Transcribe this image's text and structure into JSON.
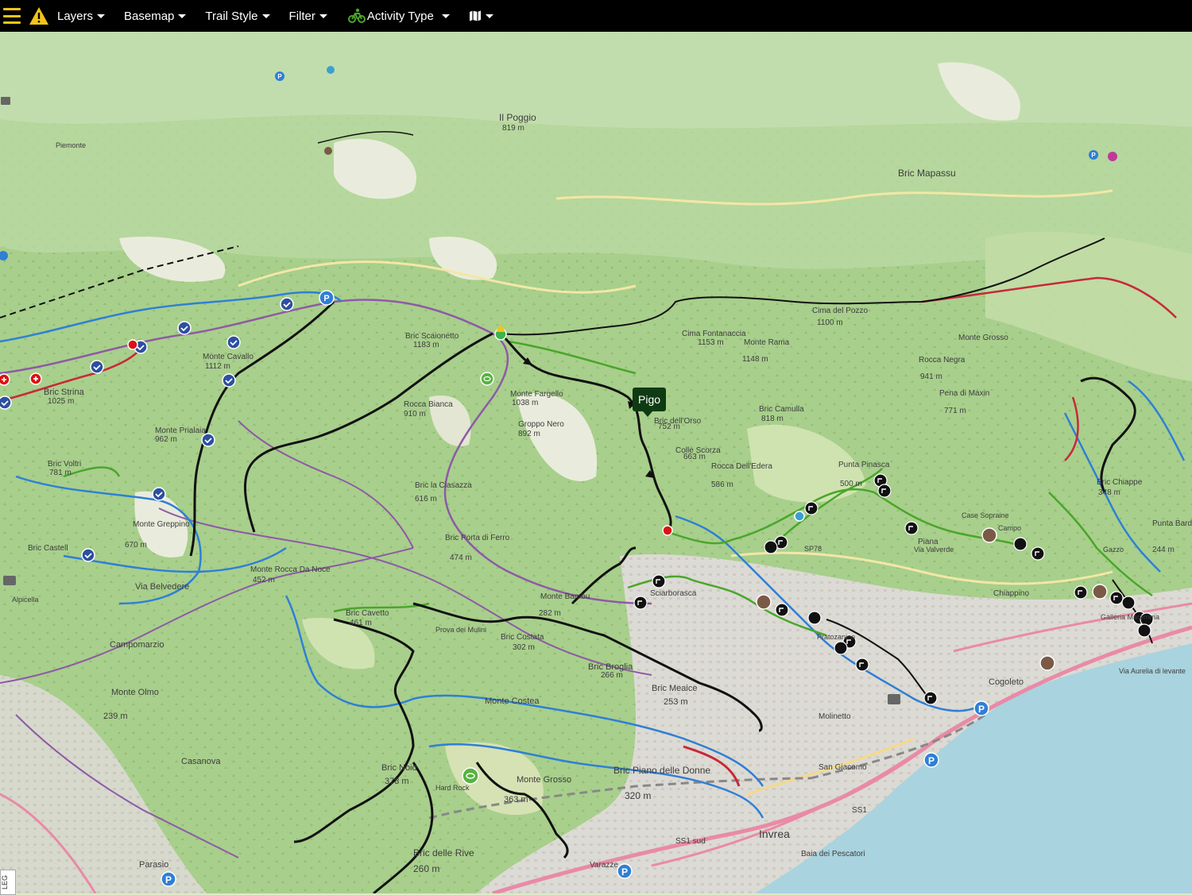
{
  "toolbar": {
    "menus": [
      {
        "label": "Layers"
      },
      {
        "label": "Basemap"
      },
      {
        "label": "Trail Style"
      },
      {
        "label": "Filter"
      },
      {
        "label": "Activity Type"
      }
    ]
  },
  "popup": {
    "label": "Pigo"
  },
  "legend": {
    "label": "LEG"
  },
  "places": [
    {
      "name": "Il Poggio",
      "elev": "819 m"
    },
    {
      "name": "Bric Mapassu"
    },
    {
      "name": "Bric Scaionetto",
      "elev": "1183 m"
    },
    {
      "name": "Monte Cavallo",
      "elev": "1112 m"
    },
    {
      "name": "Bric Strina",
      "elev": "1025 m"
    },
    {
      "name": "Monte Prialaia",
      "elev": "962 m"
    },
    {
      "name": "Bric Voltri",
      "elev": "781 m"
    },
    {
      "name": "Monte Fargello",
      "elev": "1038 m"
    },
    {
      "name": "Groppo Nero",
      "elev": "892 m"
    },
    {
      "name": "Rocca Bianca",
      "elev": "910 m"
    },
    {
      "name": "Bric la Ciasazza",
      "elev": "616 m"
    },
    {
      "name": "Bric dell'Orso",
      "elev": "752 m"
    },
    {
      "name": "Colle Scorza",
      "elev": "663 m"
    },
    {
      "name": "Rocca Dell'Edera",
      "elev": "586 m"
    },
    {
      "name": "Cima Fontanaccia",
      "elev": "1153 m"
    },
    {
      "name": "Monte Rama",
      "elev": "1148 m"
    },
    {
      "name": "Cima del Pozzo",
      "elev": "1100 m"
    },
    {
      "name": "Rocca Negra",
      "elev": "941 m"
    },
    {
      "name": "Pena di Maxin",
      "elev": "771 m"
    },
    {
      "name": "Monte Grosso"
    },
    {
      "name": "Bric Camulla",
      "elev": "818 m"
    },
    {
      "name": "Punta Pinasca",
      "elev": "500 m"
    },
    {
      "name": "Bric Chiappe",
      "elev": "348 m"
    },
    {
      "name": "Punta Bardella",
      "elev": "244 m"
    },
    {
      "name": "Monte Greppino",
      "elev": "670 m"
    },
    {
      "name": "Bric Castell"
    },
    {
      "name": "Monte Rocca Da Noce",
      "elev": "452 m"
    },
    {
      "name": "Bric Porta di Ferro",
      "elev": "474 m"
    },
    {
      "name": "Monte Bambu",
      "elev": "282 m"
    },
    {
      "name": "Bric Cavetto",
      "elev": "461 m"
    },
    {
      "name": "Bric Costata",
      "elev": "302 m"
    },
    {
      "name": "Bric Broglia",
      "elev": "266 m"
    },
    {
      "name": "Bric Meaice",
      "elev": "253 m"
    },
    {
      "name": "Monte Costea"
    },
    {
      "name": "Bric Noid",
      "elev": "378 m"
    },
    {
      "name": "Monte Grosso",
      "elev": "363 m"
    },
    {
      "name": "Bric Piano delle Donne",
      "elev": "320 m"
    },
    {
      "name": "Bric delle Rive",
      "elev": "260 m"
    },
    {
      "name": "Monte Olmo",
      "elev": "239 m"
    },
    {
      "name": "Campomarzio"
    },
    {
      "name": "Casanova"
    },
    {
      "name": "Via Belvedere"
    },
    {
      "name": "Sciarborasca"
    },
    {
      "name": "Piana"
    },
    {
      "name": "Chiappino"
    },
    {
      "name": "Molinetto"
    },
    {
      "name": "San Giacomo"
    },
    {
      "name": "Cogoleto"
    },
    {
      "name": "Invrea"
    },
    {
      "name": "Parasio"
    },
    {
      "name": "Varazze"
    },
    {
      "name": "Baia dei Pescatori"
    },
    {
      "name": "SS1 sud"
    },
    {
      "name": "SS1"
    },
    {
      "name": "SP78"
    },
    {
      "name": "Via Aurelia di levante"
    },
    {
      "name": "Case Sopraine"
    },
    {
      "name": "Campo"
    },
    {
      "name": "Gazzo"
    },
    {
      "name": "Pratozanino"
    },
    {
      "name": "Hard Rock"
    },
    {
      "name": "Prova dei Mulini"
    },
    {
      "name": "Piemonte"
    },
    {
      "name": "Alpicella"
    },
    {
      "name": "Via Valverde"
    },
    {
      "name": "Galleria Maremma"
    }
  ],
  "colors": {
    "toolbar_bg": "#000000",
    "accent": "#f0c419",
    "popup_bg": "#0f3b13",
    "sea": "#a9d3df",
    "forest": "#a9d08e",
    "trail_black": "#111111",
    "trail_blue": "#2f7fd6",
    "trail_green": "#4aa62a",
    "trail_purple": "#8e5aa6",
    "trail_red": "#c8283a"
  },
  "icons": [
    "hamburger-icon",
    "warning-icon",
    "activity-type-icon",
    "map-icon",
    "parking-icon",
    "checkmark-marker-icon",
    "sign-marker-icon",
    "first-aid-icon",
    "viewpoint-icon"
  ]
}
